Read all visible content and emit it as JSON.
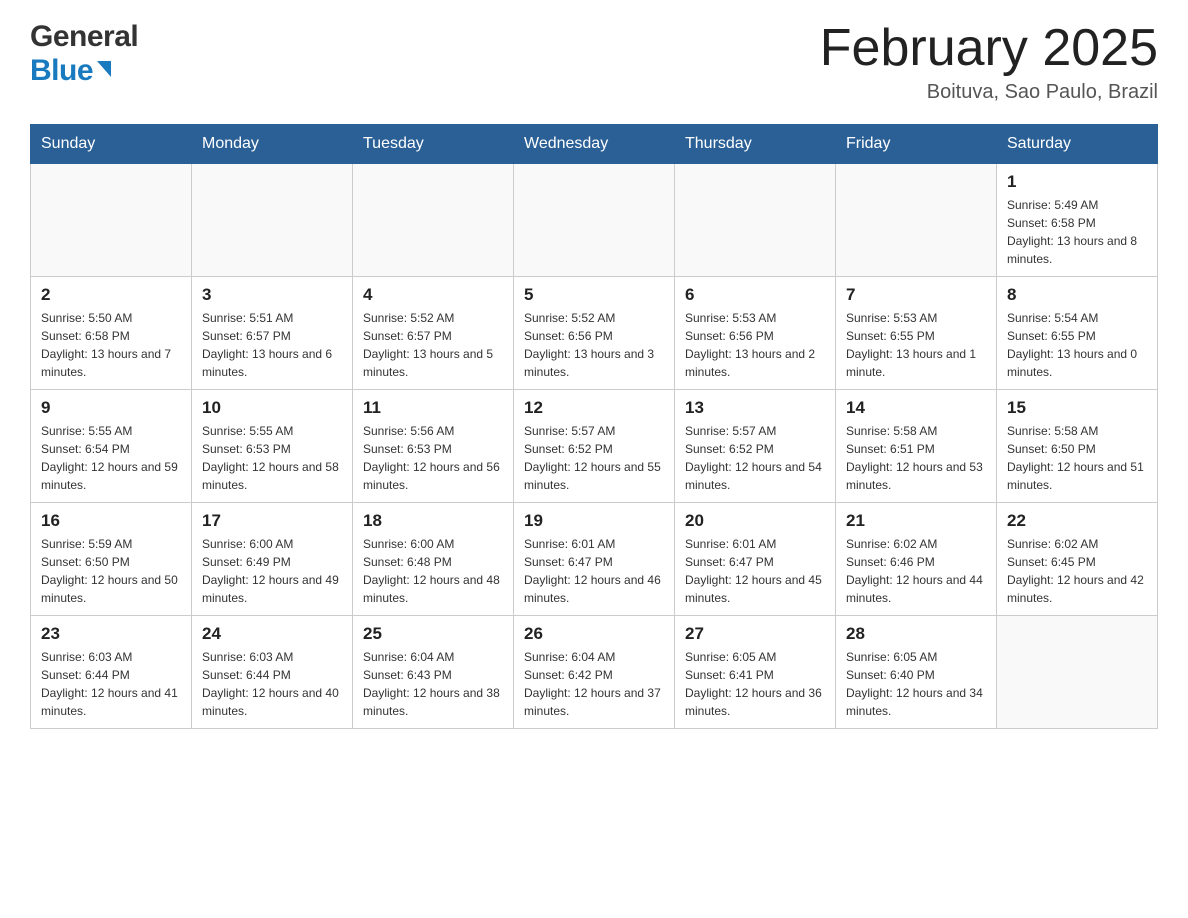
{
  "header": {
    "logo_general": "General",
    "logo_blue": "Blue",
    "title": "February 2025",
    "location": "Boituva, Sao Paulo, Brazil"
  },
  "weekdays": [
    "Sunday",
    "Monday",
    "Tuesday",
    "Wednesday",
    "Thursday",
    "Friday",
    "Saturday"
  ],
  "weeks": [
    [
      {
        "day": "",
        "info": ""
      },
      {
        "day": "",
        "info": ""
      },
      {
        "day": "",
        "info": ""
      },
      {
        "day": "",
        "info": ""
      },
      {
        "day": "",
        "info": ""
      },
      {
        "day": "",
        "info": ""
      },
      {
        "day": "1",
        "info": "Sunrise: 5:49 AM\nSunset: 6:58 PM\nDaylight: 13 hours and 8 minutes."
      }
    ],
    [
      {
        "day": "2",
        "info": "Sunrise: 5:50 AM\nSunset: 6:58 PM\nDaylight: 13 hours and 7 minutes."
      },
      {
        "day": "3",
        "info": "Sunrise: 5:51 AM\nSunset: 6:57 PM\nDaylight: 13 hours and 6 minutes."
      },
      {
        "day": "4",
        "info": "Sunrise: 5:52 AM\nSunset: 6:57 PM\nDaylight: 13 hours and 5 minutes."
      },
      {
        "day": "5",
        "info": "Sunrise: 5:52 AM\nSunset: 6:56 PM\nDaylight: 13 hours and 3 minutes."
      },
      {
        "day": "6",
        "info": "Sunrise: 5:53 AM\nSunset: 6:56 PM\nDaylight: 13 hours and 2 minutes."
      },
      {
        "day": "7",
        "info": "Sunrise: 5:53 AM\nSunset: 6:55 PM\nDaylight: 13 hours and 1 minute."
      },
      {
        "day": "8",
        "info": "Sunrise: 5:54 AM\nSunset: 6:55 PM\nDaylight: 13 hours and 0 minutes."
      }
    ],
    [
      {
        "day": "9",
        "info": "Sunrise: 5:55 AM\nSunset: 6:54 PM\nDaylight: 12 hours and 59 minutes."
      },
      {
        "day": "10",
        "info": "Sunrise: 5:55 AM\nSunset: 6:53 PM\nDaylight: 12 hours and 58 minutes."
      },
      {
        "day": "11",
        "info": "Sunrise: 5:56 AM\nSunset: 6:53 PM\nDaylight: 12 hours and 56 minutes."
      },
      {
        "day": "12",
        "info": "Sunrise: 5:57 AM\nSunset: 6:52 PM\nDaylight: 12 hours and 55 minutes."
      },
      {
        "day": "13",
        "info": "Sunrise: 5:57 AM\nSunset: 6:52 PM\nDaylight: 12 hours and 54 minutes."
      },
      {
        "day": "14",
        "info": "Sunrise: 5:58 AM\nSunset: 6:51 PM\nDaylight: 12 hours and 53 minutes."
      },
      {
        "day": "15",
        "info": "Sunrise: 5:58 AM\nSunset: 6:50 PM\nDaylight: 12 hours and 51 minutes."
      }
    ],
    [
      {
        "day": "16",
        "info": "Sunrise: 5:59 AM\nSunset: 6:50 PM\nDaylight: 12 hours and 50 minutes."
      },
      {
        "day": "17",
        "info": "Sunrise: 6:00 AM\nSunset: 6:49 PM\nDaylight: 12 hours and 49 minutes."
      },
      {
        "day": "18",
        "info": "Sunrise: 6:00 AM\nSunset: 6:48 PM\nDaylight: 12 hours and 48 minutes."
      },
      {
        "day": "19",
        "info": "Sunrise: 6:01 AM\nSunset: 6:47 PM\nDaylight: 12 hours and 46 minutes."
      },
      {
        "day": "20",
        "info": "Sunrise: 6:01 AM\nSunset: 6:47 PM\nDaylight: 12 hours and 45 minutes."
      },
      {
        "day": "21",
        "info": "Sunrise: 6:02 AM\nSunset: 6:46 PM\nDaylight: 12 hours and 44 minutes."
      },
      {
        "day": "22",
        "info": "Sunrise: 6:02 AM\nSunset: 6:45 PM\nDaylight: 12 hours and 42 minutes."
      }
    ],
    [
      {
        "day": "23",
        "info": "Sunrise: 6:03 AM\nSunset: 6:44 PM\nDaylight: 12 hours and 41 minutes."
      },
      {
        "day": "24",
        "info": "Sunrise: 6:03 AM\nSunset: 6:44 PM\nDaylight: 12 hours and 40 minutes."
      },
      {
        "day": "25",
        "info": "Sunrise: 6:04 AM\nSunset: 6:43 PM\nDaylight: 12 hours and 38 minutes."
      },
      {
        "day": "26",
        "info": "Sunrise: 6:04 AM\nSunset: 6:42 PM\nDaylight: 12 hours and 37 minutes."
      },
      {
        "day": "27",
        "info": "Sunrise: 6:05 AM\nSunset: 6:41 PM\nDaylight: 12 hours and 36 minutes."
      },
      {
        "day": "28",
        "info": "Sunrise: 6:05 AM\nSunset: 6:40 PM\nDaylight: 12 hours and 34 minutes."
      },
      {
        "day": "",
        "info": ""
      }
    ]
  ]
}
